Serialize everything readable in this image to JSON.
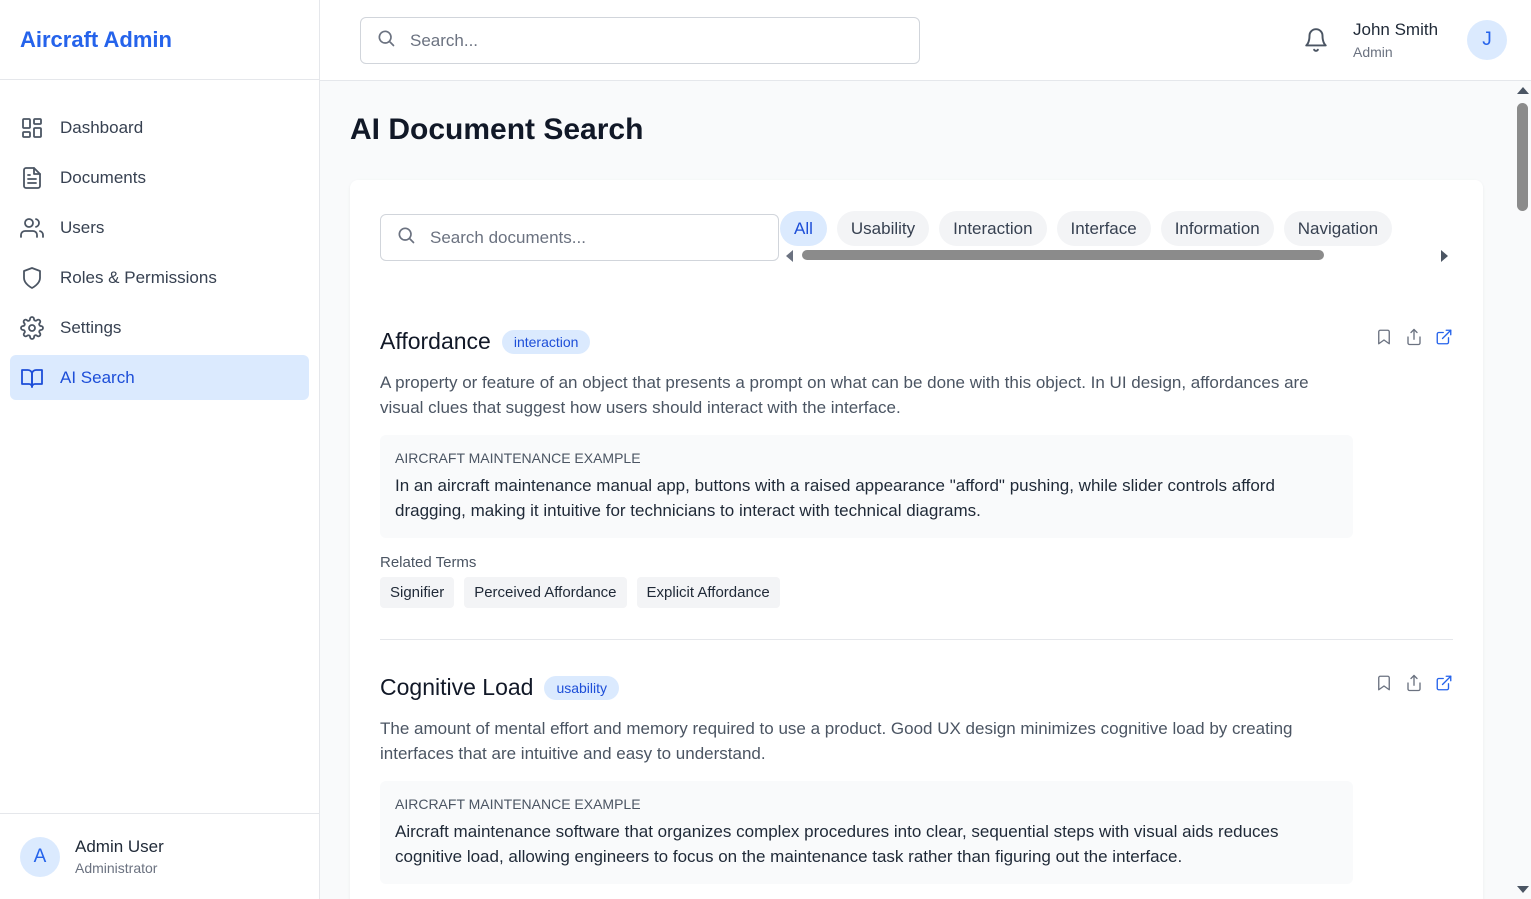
{
  "brand": {
    "title": "Aircraft Admin"
  },
  "sidebar": {
    "items": [
      {
        "label": "Dashboard",
        "icon": "grid-icon"
      },
      {
        "label": "Documents",
        "icon": "document-icon"
      },
      {
        "label": "Users",
        "icon": "users-icon"
      },
      {
        "label": "Roles & Permissions",
        "icon": "shield-icon"
      },
      {
        "label": "Settings",
        "icon": "gear-icon"
      },
      {
        "label": "AI Search",
        "icon": "book-open-icon",
        "active": true
      }
    ],
    "footer_user": {
      "initial": "A",
      "name": "Admin User",
      "role": "Administrator"
    }
  },
  "header": {
    "search_placeholder": "Search...",
    "user": {
      "name": "John Smith",
      "role": "Admin",
      "initial": "J"
    }
  },
  "main": {
    "title": "AI Document Search",
    "doc_search_placeholder": "Search documents...",
    "filters": [
      "All",
      "Usability",
      "Interaction",
      "Interface",
      "Information",
      "Navigation"
    ],
    "active_filter": "All",
    "entries": [
      {
        "title": "Affordance",
        "tag": "interaction",
        "description": "A property or feature of an object that presents a prompt on what can be done with this object. In UI design, affordances are visual clues that suggest how users should interact with the interface.",
        "example_label": "Aircraft Maintenance Example",
        "example_text": "In an aircraft maintenance manual app, buttons with a raised appearance \"afford\" pushing, while slider controls afford dragging, making it intuitive for technicians to interact with technical diagrams.",
        "related_label": "Related Terms",
        "related": [
          "Signifier",
          "Perceived Affordance",
          "Explicit Affordance"
        ]
      },
      {
        "title": "Cognitive Load",
        "tag": "usability",
        "description": "The amount of mental effort and memory required to use a product. Good UX design minimizes cognitive load by creating interfaces that are intuitive and easy to understand.",
        "example_label": "Aircraft Maintenance Example",
        "example_text": "Aircraft maintenance software that organizes complex procedures into clear, sequential steps with visual aids reduces cognitive load, allowing engineers to focus on the maintenance task rather than figuring out the interface."
      }
    ]
  },
  "colors": {
    "accent": "#2563eb",
    "active_bg": "#dbeafe",
    "text": "#111827",
    "muted": "#6b7280"
  }
}
